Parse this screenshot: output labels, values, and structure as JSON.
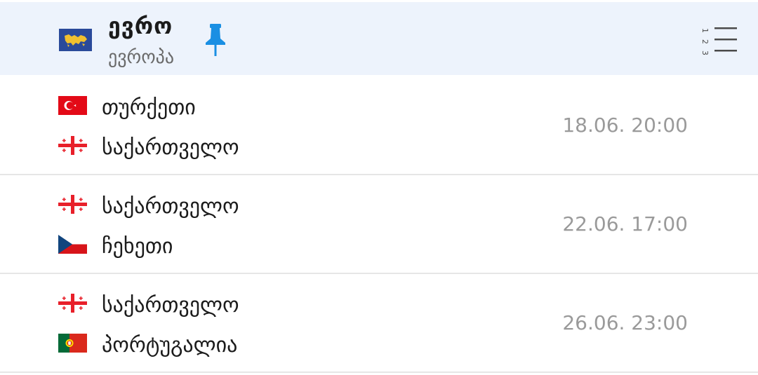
{
  "league": {
    "title": "ევრო",
    "subtitle": "ევროპა",
    "flag_icon": "europe-map-flag-icon",
    "pin_icon": "pin-icon",
    "standings_icon": "standings-list-icon",
    "colors": {
      "header_bg": "#edf3fc",
      "pin": "#1a8fe3",
      "europe_flag_bg": "#2a4a9a",
      "europe_flag_map": "#f0c030"
    }
  },
  "matches": [
    {
      "home": {
        "name": "თურქეთი",
        "flag": "turkey-flag-icon"
      },
      "away": {
        "name": "საქართველო",
        "flag": "georgia-flag-icon"
      },
      "time": "18.06. 20:00"
    },
    {
      "home": {
        "name": "საქართველო",
        "flag": "georgia-flag-icon"
      },
      "away": {
        "name": "ჩეხეთი",
        "flag": "czechia-flag-icon"
      },
      "time": "22.06. 17:00"
    },
    {
      "home": {
        "name": "საქართველო",
        "flag": "georgia-flag-icon"
      },
      "away": {
        "name": "პორტუგალია",
        "flag": "portugal-flag-icon"
      },
      "time": "26.06. 23:00"
    }
  ]
}
